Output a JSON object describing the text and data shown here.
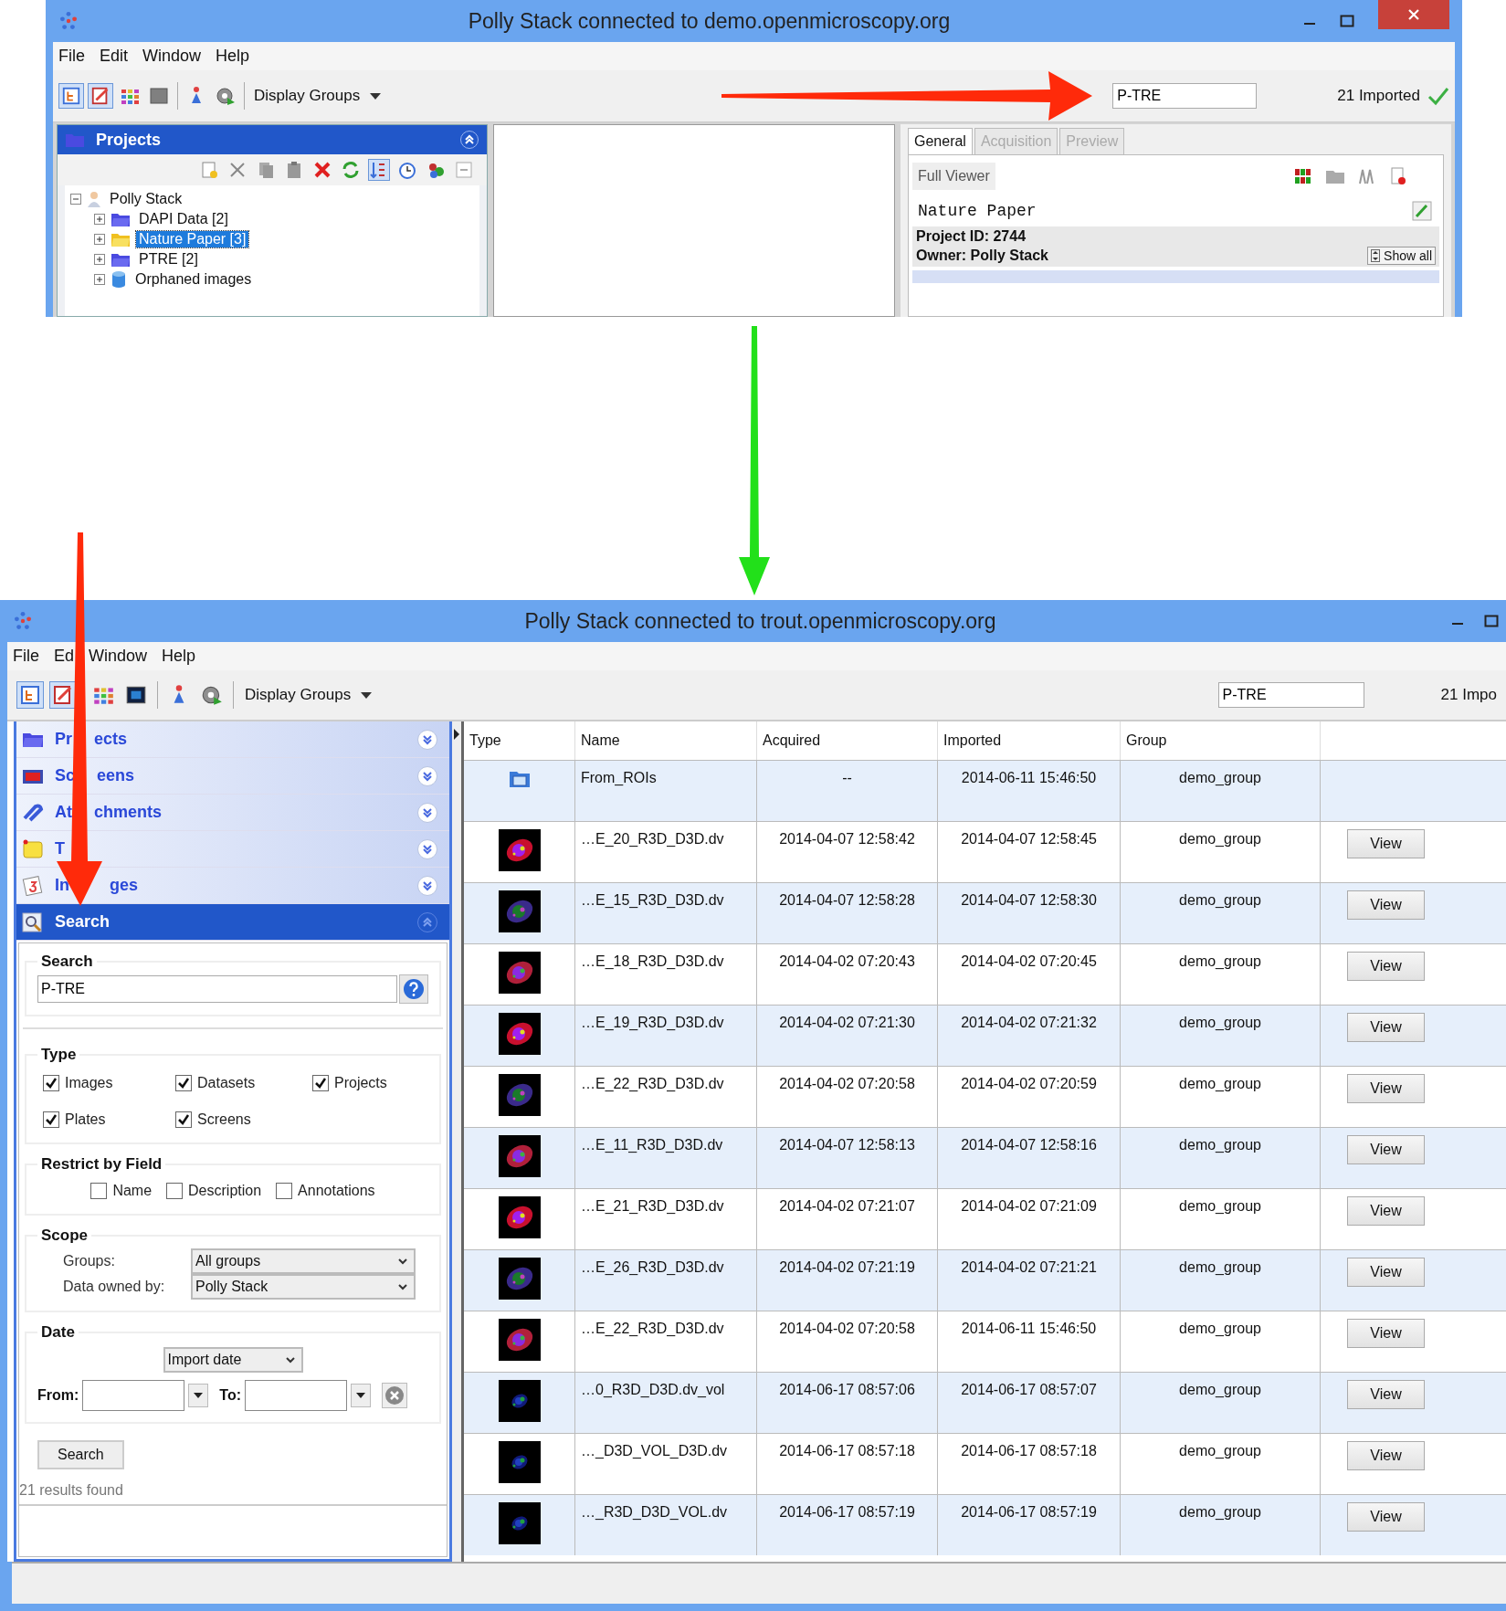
{
  "top_window": {
    "title": "Polly Stack connected to demo.openmicroscopy.org",
    "menu": [
      "File",
      "Edit",
      "Window",
      "Help"
    ],
    "toolbar": {
      "groups_menu": "Display Groups",
      "search": "P-TRE",
      "imported": "21 Imported"
    },
    "projects_panel": {
      "title": "Projects",
      "expanded": true,
      "tree": [
        {
          "label": "Polly Stack",
          "kind": "user",
          "selected": false,
          "expanded": true,
          "children": [
            {
              "label": "DAPI Data [2]",
              "kind": "project",
              "selected": false,
              "expanded": false
            },
            {
              "label": "Nature Paper [3]",
              "kind": "project",
              "selected": true,
              "expanded": false
            },
            {
              "label": "PTRE [2]",
              "kind": "project",
              "selected": false,
              "expanded": false
            },
            {
              "label": "Orphaned images",
              "kind": "orphans",
              "selected": false,
              "expanded": false
            }
          ]
        }
      ]
    },
    "details": {
      "tabs": [
        {
          "label": "General",
          "selected": true,
          "disabled": false
        },
        {
          "label": "Acquisition",
          "selected": false,
          "disabled": true
        },
        {
          "label": "Preview",
          "selected": false,
          "disabled": true
        }
      ],
      "viewer_button": "Full Viewer",
      "name": "Nature Paper",
      "project_id": "Project ID: 2744",
      "owner": "Owner: Polly Stack",
      "show_all": "Show all"
    }
  },
  "bottom_window": {
    "title": "Polly Stack connected to trout.openmicroscopy.org",
    "menu": [
      "File",
      "Ed",
      "Window",
      "Help"
    ],
    "toolbar": {
      "groups_menu": "Display Groups",
      "search": "P-TRE",
      "imported": "21 Impo"
    },
    "sections": [
      {
        "label": [
          "Pr",
          "ects"
        ],
        "kind": "projects",
        "expanded": false
      },
      {
        "label": [
          "Sc",
          "eens"
        ],
        "kind": "screens",
        "expanded": false
      },
      {
        "label": [
          "At",
          "chments"
        ],
        "kind": "attachments",
        "expanded": false
      },
      {
        "label": [
          "T"
        ],
        "kind": "tags",
        "expanded": false
      },
      {
        "label": [
          "In",
          "ges"
        ],
        "kind": "images",
        "expanded": false
      },
      {
        "label": [
          "Search"
        ],
        "kind": "search",
        "expanded": true
      }
    ],
    "search_panel": {
      "search_title": "Search",
      "query": "P-TRE",
      "type_title": "Type",
      "types": [
        {
          "label": "Images",
          "checked": true
        },
        {
          "label": "Datasets",
          "checked": true
        },
        {
          "label": "Projects",
          "checked": true
        },
        {
          "label": "Plates",
          "checked": true
        },
        {
          "label": "Screens",
          "checked": true
        }
      ],
      "restrict_title": "Restrict by Field",
      "fields": [
        {
          "label": "Name",
          "checked": false
        },
        {
          "label": "Description",
          "checked": false
        },
        {
          "label": "Annotations",
          "checked": false
        }
      ],
      "scope_title": "Scope",
      "groups_label": "Groups:",
      "groups_value": "All groups",
      "owner_label": "Data owned by:",
      "owner_value": "Polly Stack",
      "date_title": "Date",
      "date_type": "Import date",
      "from_label": "From:",
      "to_label": "To:",
      "search_button": "Search",
      "results": "21 results found"
    },
    "table": {
      "columns": [
        "Type",
        "Name",
        "Acquired",
        "Imported",
        "Group"
      ],
      "rows": [
        {
          "kind": "dataset",
          "name": "From_ROIs",
          "acquired": "--",
          "imported": "2014-06-11 15:46:50",
          "group": "demo_group"
        },
        {
          "name": "…E_20_R3D_D3D.dv",
          "acquired": "2014-04-07 12:58:42",
          "imported": "2014-04-07 12:58:45",
          "group": "demo_group",
          "action": "View"
        },
        {
          "name": "…E_15_R3D_D3D.dv",
          "acquired": "2014-04-07 12:58:28",
          "imported": "2014-04-07 12:58:30",
          "group": "demo_group",
          "action": "View"
        },
        {
          "name": "…E_18_R3D_D3D.dv",
          "acquired": "2014-04-02 07:20:43",
          "imported": "2014-04-02 07:20:45",
          "group": "demo_group",
          "action": "View"
        },
        {
          "name": "…E_19_R3D_D3D.dv",
          "acquired": "2014-04-02 07:21:30",
          "imported": "2014-04-02 07:21:32",
          "group": "demo_group",
          "action": "View"
        },
        {
          "name": "…E_22_R3D_D3D.dv",
          "acquired": "2014-04-02 07:20:58",
          "imported": "2014-04-02 07:20:59",
          "group": "demo_group",
          "action": "View"
        },
        {
          "name": "…E_11_R3D_D3D.dv",
          "acquired": "2014-04-07 12:58:13",
          "imported": "2014-04-07 12:58:16",
          "group": "demo_group",
          "action": "View"
        },
        {
          "name": "…E_21_R3D_D3D.dv",
          "acquired": "2014-04-02 07:21:07",
          "imported": "2014-04-02 07:21:09",
          "group": "demo_group",
          "action": "View"
        },
        {
          "name": "…E_26_R3D_D3D.dv",
          "acquired": "2014-04-02 07:21:19",
          "imported": "2014-04-02 07:21:21",
          "group": "demo_group",
          "action": "View"
        },
        {
          "name": "…E_22_R3D_D3D.dv",
          "acquired": "2014-04-02 07:20:58",
          "imported": "2014-06-11 15:46:50",
          "group": "demo_group",
          "action": "View"
        },
        {
          "name": "…0_R3D_D3D.dv_vol",
          "acquired": "2014-06-17 08:57:06",
          "imported": "2014-06-17 08:57:07",
          "group": "demo_group",
          "action": "View"
        },
        {
          "name": "…_D3D_VOL_D3D.dv",
          "acquired": "2014-06-17 08:57:18",
          "imported": "2014-06-17 08:57:18",
          "group": "demo_group",
          "action": "View"
        },
        {
          "name": "…_R3D_D3D_VOL.dv",
          "acquired": "2014-06-17 08:57:19",
          "imported": "2014-06-17 08:57:19",
          "group": "demo_group",
          "action": "View"
        }
      ]
    }
  }
}
